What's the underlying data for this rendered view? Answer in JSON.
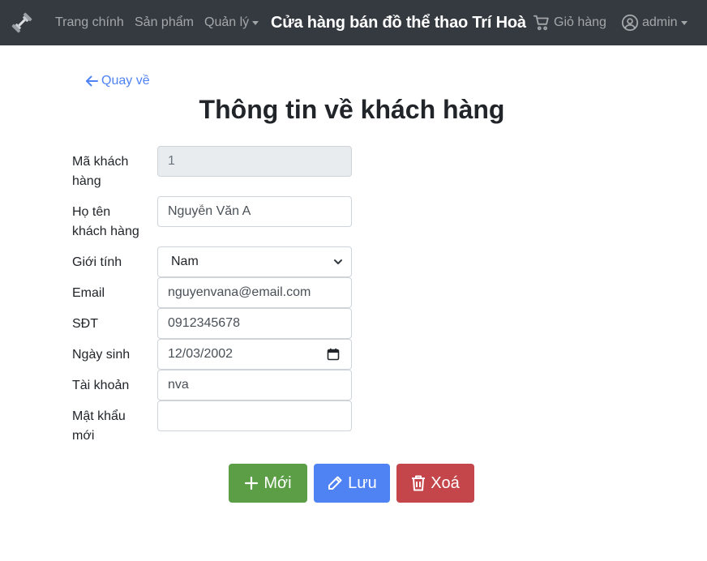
{
  "navbar": {
    "items": [
      "Trang chính",
      "Sản phẩm",
      "Quản lý"
    ],
    "brand": "Cửa hàng bán đồ thể thao Trí Hoà",
    "cart_label": "Giỏ hàng",
    "user_label": "admin"
  },
  "back_link": "Quay về",
  "page_title": "Thông tin về khách hàng",
  "form": {
    "customer_id": {
      "label_line1": "Mã khách",
      "label_line2": "hàng",
      "value": "1"
    },
    "full_name": {
      "label_line1": "Họ tên",
      "label_line2": "khách hàng",
      "value": "Nguyễn Văn A"
    },
    "gender": {
      "label": "Giới tính",
      "value": "Nam"
    },
    "email": {
      "label": "Email",
      "value": "nguyenvana@email.com"
    },
    "phone": {
      "label": "SĐT",
      "value": "0912345678"
    },
    "birthday": {
      "label": "Ngày sinh",
      "value": "12/03/2002"
    },
    "account": {
      "label": "Tài khoản",
      "value": "nva"
    },
    "new_password": {
      "label_line1": "Mật khẩu",
      "label_line2": "mới",
      "value": ""
    }
  },
  "buttons": {
    "new_label": "Mới",
    "save_label": "Lưu",
    "delete_label": "Xoá"
  },
  "colors": {
    "navbar_bg": "#343a40",
    "link": "#4f83f3",
    "new_button": "#5b9e46",
    "save_button": "#4f83f3",
    "delete_button": "#c4464a"
  }
}
